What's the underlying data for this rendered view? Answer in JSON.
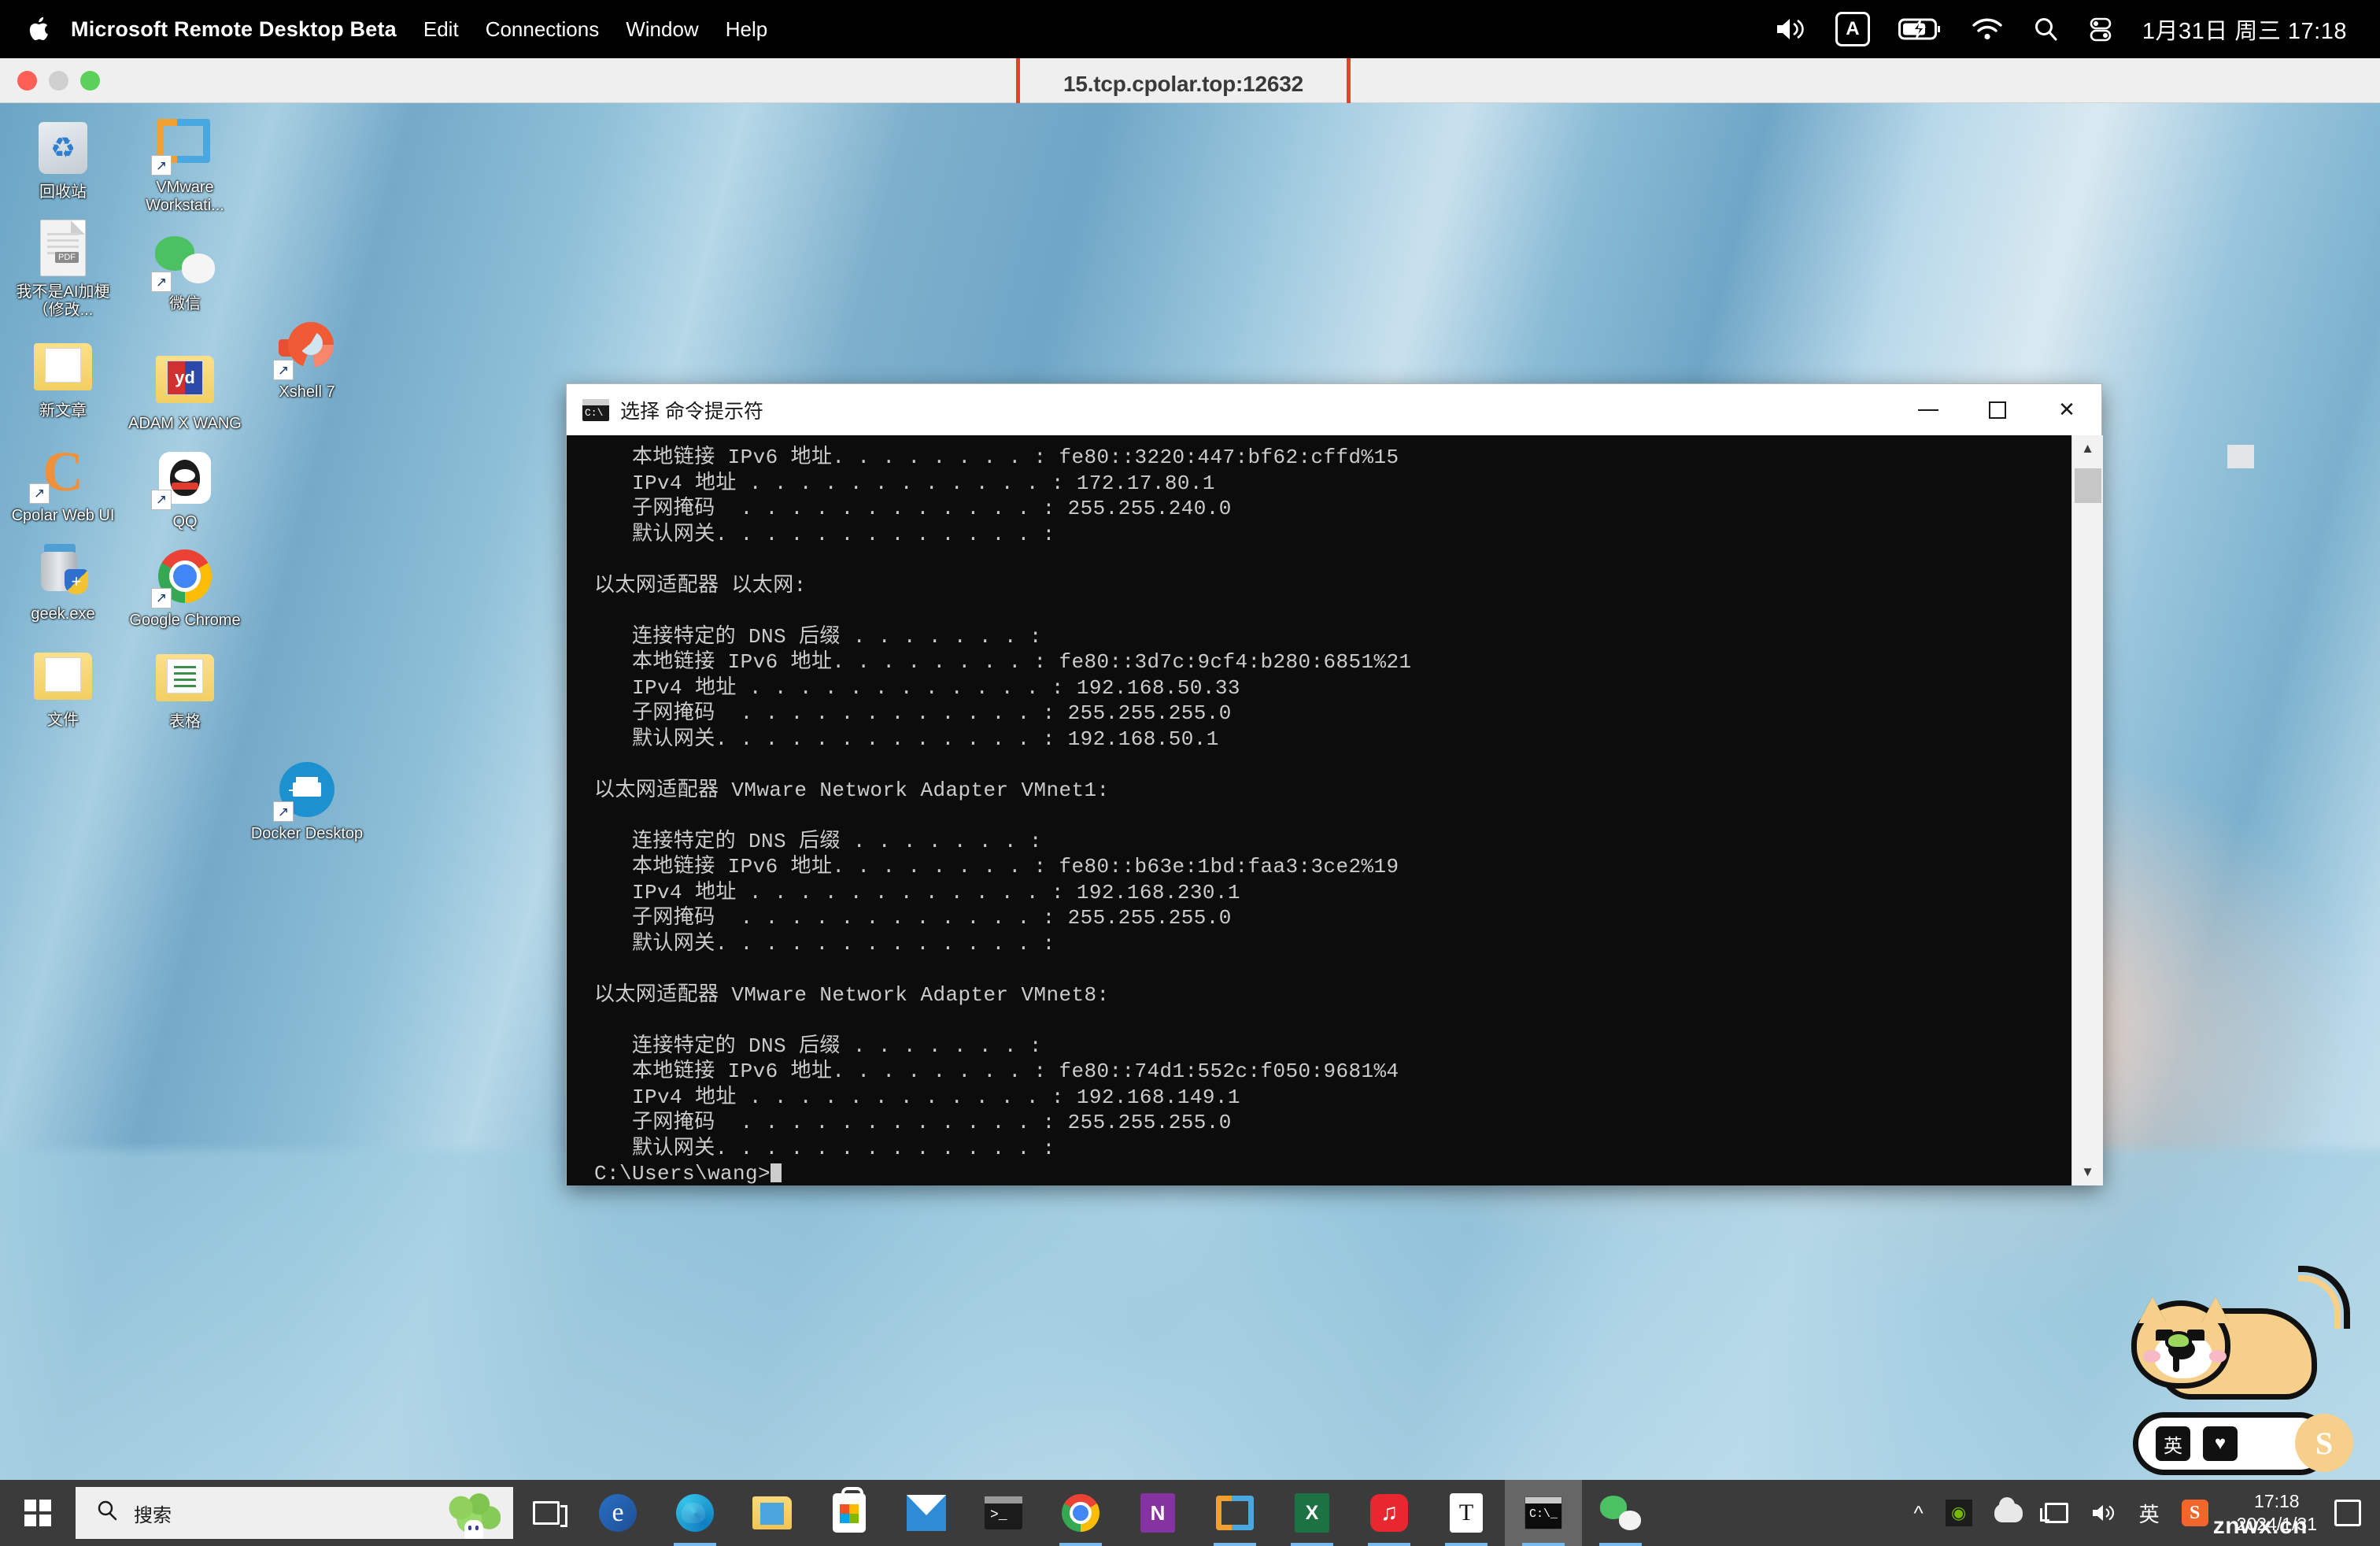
{
  "mac_menubar": {
    "apple_icon": "apple-icon",
    "app_title": "Microsoft Remote Desktop Beta",
    "menus": [
      "Edit",
      "Connections",
      "Window",
      "Help"
    ],
    "tray": {
      "volume_icon": "volume-icon",
      "input_source": "A",
      "battery_icon": "battery-charging-icon",
      "wifi_icon": "wifi-icon",
      "search_icon": "spotlight-search-icon",
      "control_center_icon": "control-center-icon",
      "clock": "1月31日 周三  17:18"
    }
  },
  "remote_window": {
    "title": "15.tcp.cpolar.top:12632",
    "highlight_color": "#e8412a",
    "traffic_lights": [
      "close",
      "minimize",
      "zoom"
    ]
  },
  "desktop": {
    "column1": [
      {
        "label": "回收站",
        "icon": "recycle-bin-icon",
        "shortcut": false
      },
      {
        "label": "我不是AI加梗（修改...",
        "icon": "document-icon",
        "shortcut": false
      },
      {
        "label": "新文章",
        "icon": "folder-icon",
        "shortcut": false
      },
      {
        "label": "Cpolar Web UI",
        "icon": "cpolar-icon",
        "shortcut": true
      },
      {
        "label": "geek.exe",
        "icon": "geek-uninstaller-icon",
        "shortcut": false
      },
      {
        "label": "文件",
        "icon": "folder-icon",
        "shortcut": false
      }
    ],
    "column2": [
      {
        "label": "VMware Workstati...",
        "icon": "vmware-workstation-icon",
        "shortcut": true
      },
      {
        "label": "微信",
        "icon": "wechat-icon",
        "shortcut": true
      },
      {
        "label": "ADAM X WANG",
        "icon": "folder-youdao-icon",
        "shortcut": false
      },
      {
        "label": "QQ",
        "icon": "qq-icon",
        "shortcut": true
      },
      {
        "label": "Google Chrome",
        "icon": "chrome-icon",
        "shortcut": true
      },
      {
        "label": "表格",
        "icon": "folder-spreadsheet-icon",
        "shortcut": false
      }
    ],
    "column3": [
      {
        "label": "Xshell 7",
        "icon": "xshell-icon",
        "shortcut": true
      },
      {
        "label": "Docker Desktop",
        "icon": "docker-icon",
        "shortcut": true
      }
    ]
  },
  "cmd_window": {
    "title": "选择 命令提示符",
    "icon": "cmd-console-icon",
    "buttons": {
      "minimize": "minimize-icon",
      "maximize": "maximize-icon",
      "close": "close-icon"
    },
    "output": "   本地链接 IPv6 地址. . . . . . . . : fe80::3220:447:bf62:cffd%15\n   IPv4 地址 . . . . . . . . . . . . : 172.17.80.1\n   子网掩码  . . . . . . . . . . . . : 255.255.240.0\n   默认网关. . . . . . . . . . . . . :\n\n以太网适配器 以太网:\n\n   连接特定的 DNS 后缀 . . . . . . . :\n   本地链接 IPv6 地址. . . . . . . . : fe80::3d7c:9cf4:b280:6851%21\n   IPv4 地址 . . . . . . . . . . . . : 192.168.50.33\n   子网掩码  . . . . . . . . . . . . : 255.255.255.0\n   默认网关. . . . . . . . . . . . . : 192.168.50.1\n\n以太网适配器 VMware Network Adapter VMnet1:\n\n   连接特定的 DNS 后缀 . . . . . . . :\n   本地链接 IPv6 地址. . . . . . . . : fe80::b63e:1bd:faa3:3ce2%19\n   IPv4 地址 . . . . . . . . . . . . : 192.168.230.1\n   子网掩码  . . . . . . . . . . . . : 255.255.255.0\n   默认网关. . . . . . . . . . . . . :\n\n以太网适配器 VMware Network Adapter VMnet8:\n\n   连接特定的 DNS 后缀 . . . . . . . :\n   本地链接 IPv6 地址. . . . . . . . : fe80::74d1:552c:f050:9681%4\n   IPv4 地址 . . . . . . . . . . . . : 192.168.149.1\n   子网掩码  . . . . . . . . . . . . : 255.255.255.0\n   默认网关. . . . . . . . . . . . . :\n",
    "prompt": "C:\\Users\\wang>",
    "scrollbar": {
      "up_icon": "chevron-up-icon",
      "down_icon": "chevron-down-icon"
    }
  },
  "taskbar": {
    "start_icon": "windows-start-icon",
    "search": {
      "icon": "search-icon",
      "placeholder": "搜索"
    },
    "task_view_icon": "task-view-icon",
    "apps": [
      {
        "name": "internet-explorer",
        "icon": "internet-explorer-icon",
        "running": false,
        "active": false
      },
      {
        "name": "microsoft-edge",
        "icon": "edge-icon",
        "running": true,
        "active": false
      },
      {
        "name": "file-explorer",
        "icon": "file-explorer-icon",
        "running": false,
        "active": false
      },
      {
        "name": "microsoft-store",
        "icon": "microsoft-store-icon",
        "running": false,
        "active": false
      },
      {
        "name": "mail",
        "icon": "mail-icon",
        "running": false,
        "active": false
      },
      {
        "name": "windows-terminal",
        "icon": "terminal-icon",
        "running": false,
        "active": false
      },
      {
        "name": "google-chrome",
        "icon": "chrome-icon",
        "running": true,
        "active": false
      },
      {
        "name": "onenote",
        "icon": "onenote-icon",
        "running": false,
        "active": false
      },
      {
        "name": "vmware-workstation",
        "icon": "vmware-icon",
        "running": true,
        "active": false
      },
      {
        "name": "excel",
        "icon": "excel-icon",
        "running": true,
        "active": false
      },
      {
        "name": "netease-music",
        "icon": "netease-music-icon",
        "running": true,
        "active": false
      },
      {
        "name": "typora",
        "icon": "typora-icon",
        "running": true,
        "active": false
      },
      {
        "name": "command-prompt",
        "icon": "cmd-icon",
        "running": true,
        "active": true
      },
      {
        "name": "wechat",
        "icon": "wechat-icon",
        "running": true,
        "active": false
      }
    ],
    "tray": {
      "overflow_icon": "chevron-up-icon",
      "items": [
        {
          "name": "nvidia-settings",
          "icon": "nvidia-icon",
          "label": ""
        },
        {
          "name": "onedrive",
          "icon": "cloud-icon",
          "label": ""
        },
        {
          "name": "network",
          "icon": "network-icon",
          "label": ""
        },
        {
          "name": "volume",
          "icon": "volume-icon",
          "label": ""
        },
        {
          "name": "input-method",
          "icon": "ime-icon",
          "label": "英"
        },
        {
          "name": "sogou-input",
          "icon": "sogou-icon",
          "label": "S"
        }
      ],
      "clock_time": "17:18",
      "clock_date": "2024/1/31",
      "notification_icon": "action-center-icon"
    },
    "watermark": "znwx.cn"
  },
  "sogou_pet": {
    "name": "sogou-input-floating-bar",
    "keys": [
      "英",
      "pet-icon"
    ],
    "brand": "S"
  }
}
